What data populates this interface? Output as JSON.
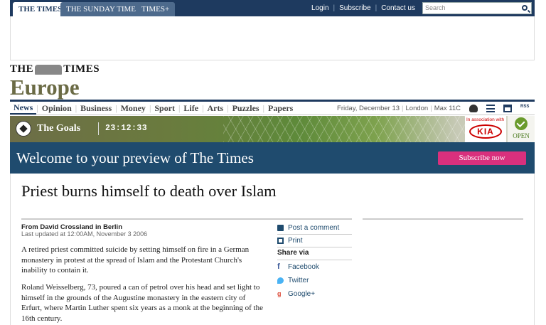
{
  "topbar": {
    "tabs": [
      "THE TIMES",
      "THE SUNDAY TIMES",
      "TIMES+"
    ],
    "links": [
      "Login",
      "Subscribe",
      "Contact us"
    ],
    "search_placeholder": "Search"
  },
  "masthead": {
    "title_left": "THE",
    "title_right": "TIMES",
    "edition": "Europe"
  },
  "nav": {
    "items": [
      "News",
      "Opinion",
      "Business",
      "Money",
      "Sport",
      "Life",
      "Arts",
      "Puzzles",
      "Papers"
    ],
    "date": "Friday, December 13",
    "location": "London",
    "weather": "Max 11C",
    "rss": "RSS"
  },
  "goals": {
    "title": "The Goals",
    "clock": "23:12:33",
    "sponsor_text": "In association with",
    "sponsor": "KIA",
    "status": "OPEN"
  },
  "welcome": {
    "text": "Welcome to your preview of The Times",
    "button": "Subscribe now"
  },
  "article": {
    "headline": "Priest burns himself to death over Islam",
    "byline": "From David Crossland in Berlin",
    "updated": "Last updated at 12:00AM, November 3 2006",
    "paragraphs": [
      "A retired priest committed suicide by setting himself on fire in a German monastery in protest at the spread of Islam and the Protestant Church's inability to contain it.",
      "Roland Weisselberg, 73, poured a can of petrol over his head and set light to himself in the grounds of the Augustine monastery in the eastern city of Erfurt, where Martin Luther spent six years as a monk at the beginning of the 16th century."
    ]
  },
  "sidebar": {
    "post_comment": "Post a comment",
    "print": "Print",
    "share_via": "Share via",
    "facebook": "Facebook",
    "twitter": "Twitter",
    "google": "Google+"
  },
  "colors": {
    "navy": "#1e3a5f",
    "band": "#1f4b6e",
    "subscribe": "#d9307d",
    "edition": "#6b6b45"
  }
}
